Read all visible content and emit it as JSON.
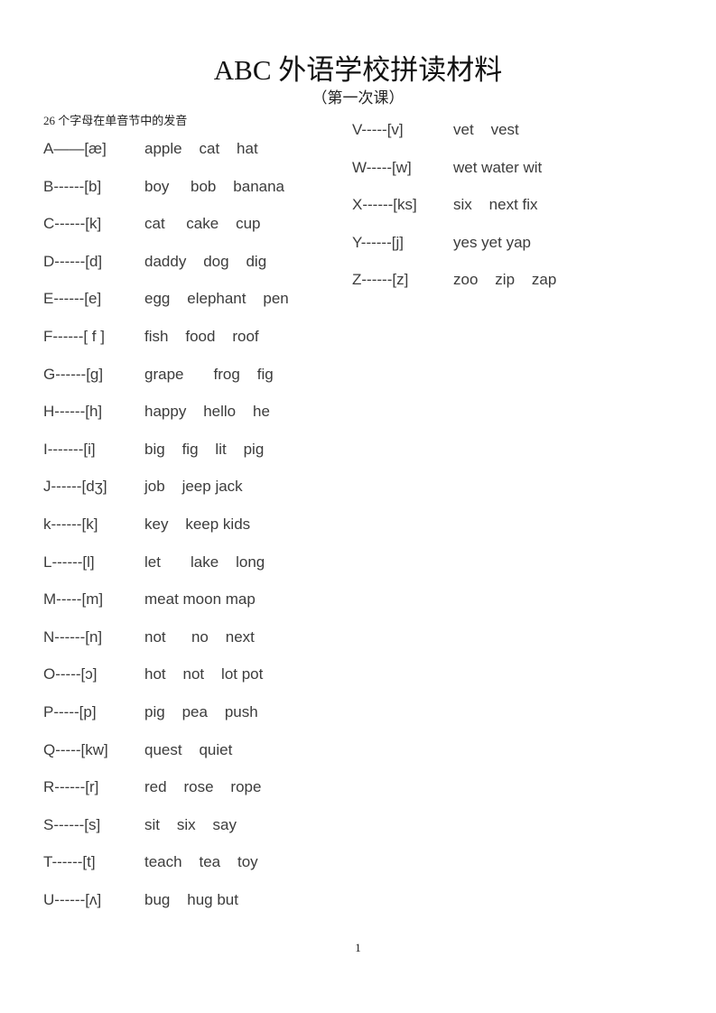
{
  "document": {
    "title": "ABC 外语学校拼读材料",
    "subtitle": "（第一次课）",
    "intro": "26 个字母在单音节中的发音",
    "page_number": "1"
  },
  "left_column": [
    {
      "letter": "A——[æ]",
      "words": "apple    cat    hat"
    },
    {
      "letter": "B------[b]",
      "words": "boy     bob    banana"
    },
    {
      "letter": "C------[k]",
      "words": "cat     cake    cup"
    },
    {
      "letter": "D------[d]",
      "words": "daddy    dog    dig"
    },
    {
      "letter": "E------[e]",
      "words": "egg    elephant    pen"
    },
    {
      "letter": "F------[ f ]",
      "words": "fish    food    roof"
    },
    {
      "letter": "G------[g]",
      "words": "grape       frog    fig"
    },
    {
      "letter": "H------[h]",
      "words": "happy    hello    he"
    },
    {
      "letter": "I-------[i]",
      "words": "big    fig    lit    pig"
    },
    {
      "letter": "J------[dʒ]",
      "words": "job    jeep jack"
    },
    {
      "letter": "k------[k]",
      "words": "key    keep kids"
    },
    {
      "letter": "L------[l]",
      "words": "let       lake    long"
    },
    {
      "letter": "M-----[m]",
      "words": "meat moon map"
    },
    {
      "letter": "N------[n]",
      "words": "not      no    next"
    },
    {
      "letter": "O-----[ɔ]",
      "words": "hot    not    lot pot"
    },
    {
      "letter": "P-----[p]",
      "words": "pig    pea    push"
    },
    {
      "letter": "Q-----[kw]",
      "words": "quest    quiet"
    },
    {
      "letter": "R------[r]",
      "words": "red    rose    rope"
    },
    {
      "letter": "S------[s]",
      "words": "sit    six    say"
    },
    {
      "letter": "T------[t]",
      "words": "teach    tea    toy"
    },
    {
      "letter": "U------[ʌ]",
      "words": "bug    hug but"
    }
  ],
  "right_column": [
    {
      "letter": "V-----[v]",
      "words": "vet    vest"
    },
    {
      "letter": "W-----[w]",
      "words": "wet water wit"
    },
    {
      "letter": "X------[ks]",
      "words": "six    next fix"
    },
    {
      "letter": "Y------[j]",
      "words": "yes yet yap"
    },
    {
      "letter": "Z------[z]",
      "words": "zoo    zip    zap"
    }
  ]
}
